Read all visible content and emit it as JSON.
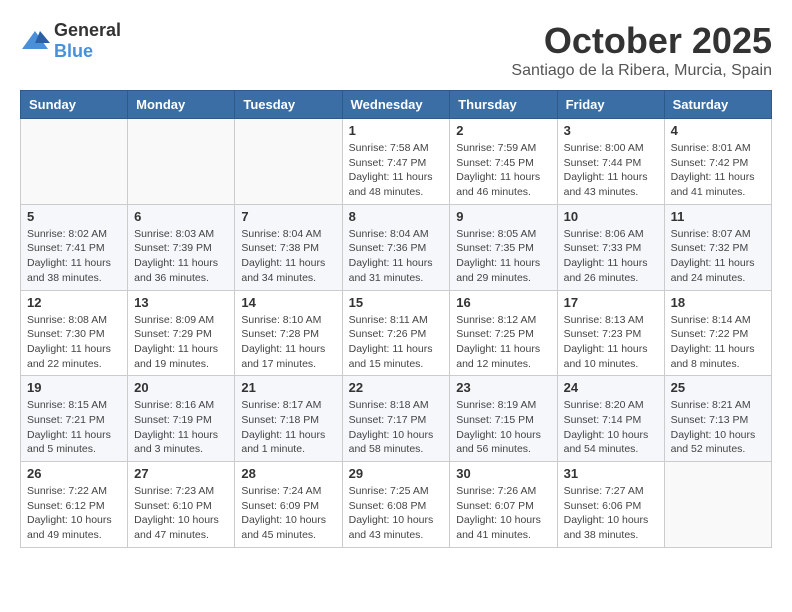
{
  "logo": {
    "text_general": "General",
    "text_blue": "Blue"
  },
  "header": {
    "month": "October 2025",
    "location": "Santiago de la Ribera, Murcia, Spain"
  },
  "weekdays": [
    "Sunday",
    "Monday",
    "Tuesday",
    "Wednesday",
    "Thursday",
    "Friday",
    "Saturday"
  ],
  "weeks": [
    [
      {
        "day": "",
        "info": ""
      },
      {
        "day": "",
        "info": ""
      },
      {
        "day": "",
        "info": ""
      },
      {
        "day": "1",
        "info": "Sunrise: 7:58 AM\nSunset: 7:47 PM\nDaylight: 11 hours and 48 minutes."
      },
      {
        "day": "2",
        "info": "Sunrise: 7:59 AM\nSunset: 7:45 PM\nDaylight: 11 hours and 46 minutes."
      },
      {
        "day": "3",
        "info": "Sunrise: 8:00 AM\nSunset: 7:44 PM\nDaylight: 11 hours and 43 minutes."
      },
      {
        "day": "4",
        "info": "Sunrise: 8:01 AM\nSunset: 7:42 PM\nDaylight: 11 hours and 41 minutes."
      }
    ],
    [
      {
        "day": "5",
        "info": "Sunrise: 8:02 AM\nSunset: 7:41 PM\nDaylight: 11 hours and 38 minutes."
      },
      {
        "day": "6",
        "info": "Sunrise: 8:03 AM\nSunset: 7:39 PM\nDaylight: 11 hours and 36 minutes."
      },
      {
        "day": "7",
        "info": "Sunrise: 8:04 AM\nSunset: 7:38 PM\nDaylight: 11 hours and 34 minutes."
      },
      {
        "day": "8",
        "info": "Sunrise: 8:04 AM\nSunset: 7:36 PM\nDaylight: 11 hours and 31 minutes."
      },
      {
        "day": "9",
        "info": "Sunrise: 8:05 AM\nSunset: 7:35 PM\nDaylight: 11 hours and 29 minutes."
      },
      {
        "day": "10",
        "info": "Sunrise: 8:06 AM\nSunset: 7:33 PM\nDaylight: 11 hours and 26 minutes."
      },
      {
        "day": "11",
        "info": "Sunrise: 8:07 AM\nSunset: 7:32 PM\nDaylight: 11 hours and 24 minutes."
      }
    ],
    [
      {
        "day": "12",
        "info": "Sunrise: 8:08 AM\nSunset: 7:30 PM\nDaylight: 11 hours and 22 minutes."
      },
      {
        "day": "13",
        "info": "Sunrise: 8:09 AM\nSunset: 7:29 PM\nDaylight: 11 hours and 19 minutes."
      },
      {
        "day": "14",
        "info": "Sunrise: 8:10 AM\nSunset: 7:28 PM\nDaylight: 11 hours and 17 minutes."
      },
      {
        "day": "15",
        "info": "Sunrise: 8:11 AM\nSunset: 7:26 PM\nDaylight: 11 hours and 15 minutes."
      },
      {
        "day": "16",
        "info": "Sunrise: 8:12 AM\nSunset: 7:25 PM\nDaylight: 11 hours and 12 minutes."
      },
      {
        "day": "17",
        "info": "Sunrise: 8:13 AM\nSunset: 7:23 PM\nDaylight: 11 hours and 10 minutes."
      },
      {
        "day": "18",
        "info": "Sunrise: 8:14 AM\nSunset: 7:22 PM\nDaylight: 11 hours and 8 minutes."
      }
    ],
    [
      {
        "day": "19",
        "info": "Sunrise: 8:15 AM\nSunset: 7:21 PM\nDaylight: 11 hours and 5 minutes."
      },
      {
        "day": "20",
        "info": "Sunrise: 8:16 AM\nSunset: 7:19 PM\nDaylight: 11 hours and 3 minutes."
      },
      {
        "day": "21",
        "info": "Sunrise: 8:17 AM\nSunset: 7:18 PM\nDaylight: 11 hours and 1 minute."
      },
      {
        "day": "22",
        "info": "Sunrise: 8:18 AM\nSunset: 7:17 PM\nDaylight: 10 hours and 58 minutes."
      },
      {
        "day": "23",
        "info": "Sunrise: 8:19 AM\nSunset: 7:15 PM\nDaylight: 10 hours and 56 minutes."
      },
      {
        "day": "24",
        "info": "Sunrise: 8:20 AM\nSunset: 7:14 PM\nDaylight: 10 hours and 54 minutes."
      },
      {
        "day": "25",
        "info": "Sunrise: 8:21 AM\nSunset: 7:13 PM\nDaylight: 10 hours and 52 minutes."
      }
    ],
    [
      {
        "day": "26",
        "info": "Sunrise: 7:22 AM\nSunset: 6:12 PM\nDaylight: 10 hours and 49 minutes."
      },
      {
        "day": "27",
        "info": "Sunrise: 7:23 AM\nSunset: 6:10 PM\nDaylight: 10 hours and 47 minutes."
      },
      {
        "day": "28",
        "info": "Sunrise: 7:24 AM\nSunset: 6:09 PM\nDaylight: 10 hours and 45 minutes."
      },
      {
        "day": "29",
        "info": "Sunrise: 7:25 AM\nSunset: 6:08 PM\nDaylight: 10 hours and 43 minutes."
      },
      {
        "day": "30",
        "info": "Sunrise: 7:26 AM\nSunset: 6:07 PM\nDaylight: 10 hours and 41 minutes."
      },
      {
        "day": "31",
        "info": "Sunrise: 7:27 AM\nSunset: 6:06 PM\nDaylight: 10 hours and 38 minutes."
      },
      {
        "day": "",
        "info": ""
      }
    ]
  ]
}
